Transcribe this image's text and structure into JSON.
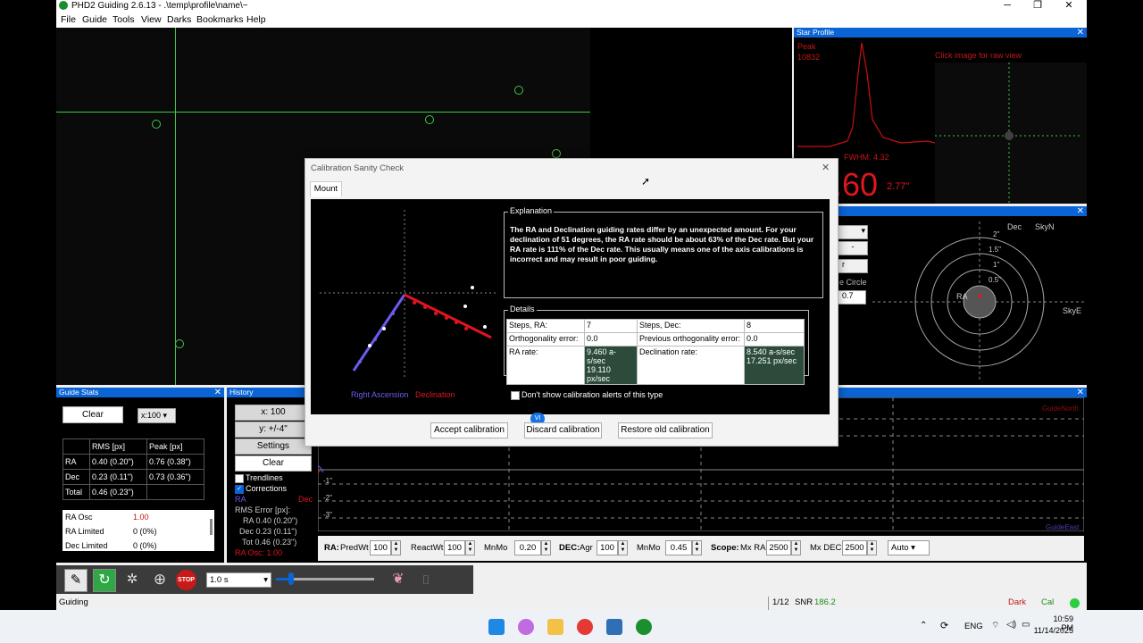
{
  "app": {
    "title": "PHD2 Guiding 2.6.13 - .\\temp\\profile\\name\\~",
    "minimize": "─",
    "maximize": "❐",
    "close": "✕"
  },
  "menu": [
    "File",
    "Guide",
    "Tools",
    "View",
    "Darks",
    "Bookmarks",
    "Help"
  ],
  "star_profile": {
    "title": "Star Profile",
    "close": "✕",
    "peak_label": "Peak",
    "peak_value": "10832",
    "hint": "Click image for raw view",
    "fwhm": "FWHM: 4.32",
    "hfd_value": ".60",
    "hfd_arcsec": "2.77\""
  },
  "target": {
    "close": "✕",
    "scale_label": "e Circle",
    "scale_value": "0.7",
    "minus": "-",
    "r_label": "r",
    "dec_label": "Dec",
    "skyn_label": "SkyN",
    "ra_label": "RA",
    "skye_label": "SkyE",
    "ticks": [
      "2\"",
      "1.5\"",
      "1\"",
      "0.5\""
    ]
  },
  "guide_stats": {
    "title": "Guide Stats",
    "close": "✕",
    "clear": "Clear",
    "scale": "x:100",
    "headers": [
      "",
      "RMS [px]",
      "Peak [px]"
    ],
    "rows": [
      [
        "RA",
        "0.40 (0.20\")",
        "0.76 (0.38\")"
      ],
      [
        "Dec",
        "0.23 (0.11\")",
        "0.73 (0.36\")"
      ],
      [
        "Total",
        "0.46 (0.23\")",
        ""
      ]
    ],
    "osc": [
      [
        "RA Osc",
        "1.00"
      ],
      [
        "RA Limited",
        "0 (0%)"
      ],
      [
        "Dec Limited",
        "0 (0%)"
      ]
    ]
  },
  "history": {
    "title": "History",
    "x_scale": "x: 100",
    "y_scale": "y: +/-4\"",
    "settings": "Settings",
    "clear": "Clear",
    "trendlines": "Trendlines",
    "corrections": "Corrections",
    "ra_label": "RA",
    "dec_label": "Dec",
    "rms_header": "RMS Error [px]:",
    "rms_ra": "RA 0.40 (0.20\")",
    "rms_dec": "Dec 0.23 (0.11\")",
    "rms_tot": "Tot 0.46 (0.23\")",
    "ra_osc": "RA Osc: 1.00",
    "graph_labels": [
      "-1\"",
      "-2\"",
      "-3\""
    ],
    "guide_north": "GuideNorth",
    "guide_east": "GuideEast",
    "close": "✕"
  },
  "params": {
    "ra_label": "RA:",
    "predwt_label": "PredWt",
    "predwt": "100",
    "reactwt_label": "ReactWt",
    "reactwt": "100",
    "mnmo_label": "MnMo",
    "mnmo_ra": "0.20",
    "dec_label": "DEC:",
    "agr_label": "Agr",
    "agr": "100",
    "mnmo_dec": "0.45",
    "scope_label": "Scope:",
    "mxra_label": "Mx RA",
    "mxra": "2500",
    "mxdec_label": "Mx DEC",
    "mxdec": "2500",
    "mode": "Auto"
  },
  "toolbar": {
    "exposure": "1.0 s",
    "stop": "STOP"
  },
  "status": {
    "left": "Guiding",
    "frame": "1/12",
    "snr_label": "SNR",
    "snr": "186.2",
    "dark": "Dark",
    "cal": "Cal"
  },
  "dialog": {
    "title": "Calibration Sanity Check",
    "close": "✕",
    "tab": "Mount",
    "legend_ra": "Right Ascension",
    "legend_dec": "Declination",
    "explanation_header": "Explanation",
    "explanation": "The RA and Declination guiding rates differ by an unexpected amount.  For your declination of 51 degrees, the RA rate should be about 63% of the Dec rate.  But your RA rate is 111% of the Dec rate.  This usually means one of the axis calibrations is incorrect and may result in poor guiding.",
    "details_header": "Details",
    "steps_ra_label": "Steps, RA:",
    "steps_ra": "7",
    "steps_dec_label": "Steps, Dec:",
    "steps_dec": "8",
    "ortho_label": "Orthogonality error:",
    "ortho": "0.0",
    "prev_ortho_label": "Previous orthogonality error:",
    "prev_ortho": "0.0",
    "ra_rate_label": "RA rate:",
    "ra_rate_1": "9.460 a-s/sec",
    "ra_rate_2": "19.110 px/sec",
    "dec_rate_label": "Declination rate:",
    "dec_rate_1": "8.540 a-s/sec",
    "dec_rate_2": "17.251 px/sec",
    "dont_show": "Don't show calibration alerts of this type",
    "accept": "Accept calibration",
    "discard": "Discard calibration",
    "restore": "Restore old calibration",
    "badge": "VI"
  },
  "taskbar": {
    "lang": "ENG",
    "time": "10:59 PM",
    "date": "11/14/2025"
  },
  "colors": {
    "accent": "#0a64d6",
    "guide_green": "#3ec93e",
    "ra_blue": "#6a5cf0",
    "dec_red": "#e0151f"
  }
}
